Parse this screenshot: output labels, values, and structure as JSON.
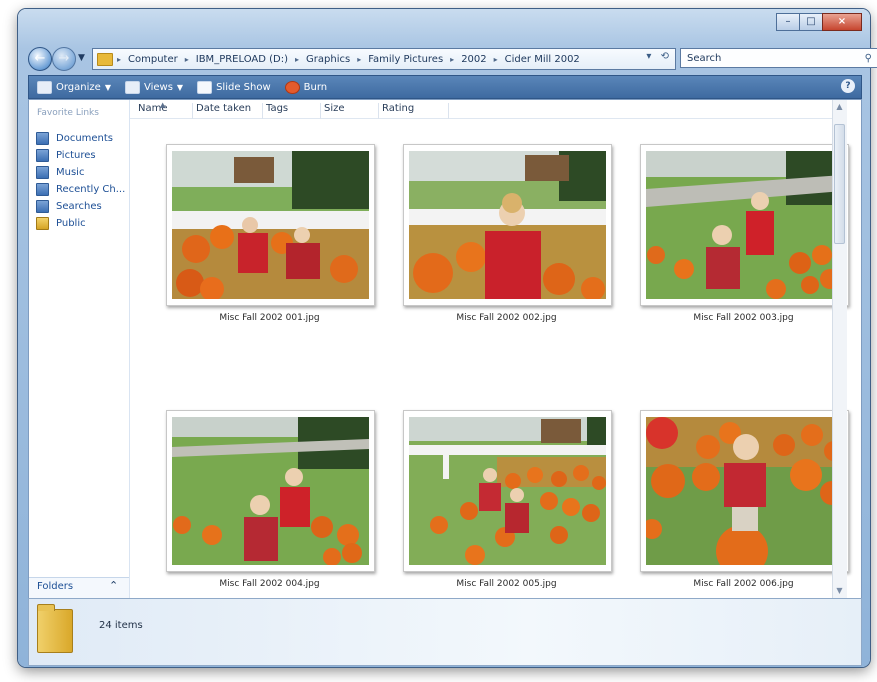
{
  "address": {
    "crumbs": [
      "Computer",
      "IBM_PRELOAD (D:)",
      "Graphics",
      "Family Pictures",
      "2002",
      "Cider Mill 2002"
    ]
  },
  "search": {
    "placeholder": "Search"
  },
  "toolbar": {
    "organize": "Organize",
    "views": "Views",
    "slideshow": "Slide Show",
    "burn": "Burn"
  },
  "nav": {
    "heading": "Favorite Links",
    "items": [
      "Documents",
      "Pictures",
      "Music",
      "Recently Ch...",
      "Searches",
      "Public"
    ],
    "folders": "Folders"
  },
  "columns": [
    "Name",
    "Date taken",
    "Tags",
    "Size",
    "Rating"
  ],
  "files": [
    {
      "name": "Misc Fall 2002 001.jpg"
    },
    {
      "name": "Misc Fall 2002 002.jpg"
    },
    {
      "name": "Misc Fall 2002 003.jpg"
    },
    {
      "name": "Misc Fall 2002 004.jpg"
    },
    {
      "name": "Misc Fall 2002 005.jpg"
    },
    {
      "name": "Misc Fall 2002 006.jpg"
    }
  ],
  "status": {
    "count": "24 items"
  }
}
